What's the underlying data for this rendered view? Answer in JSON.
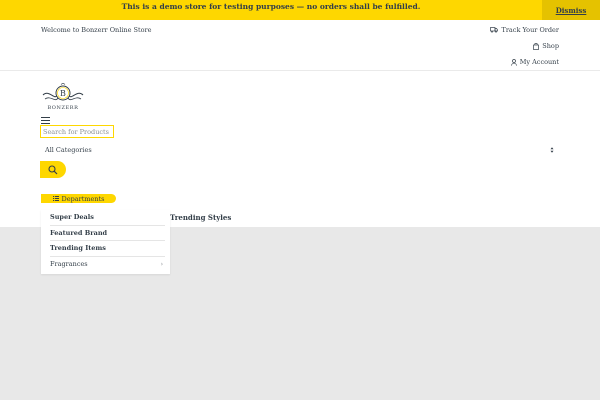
{
  "notice": {
    "text": "This is a demo store for testing purposes — no orders shall be fulfilled.",
    "dismiss_label": "Dismiss"
  },
  "topbar": {
    "welcome": "Welcome to Bonzerr Online Store",
    "links": [
      {
        "label": "Track Your Order",
        "icon": "truck-icon"
      },
      {
        "label": "Shop",
        "icon": "shopping-bag-icon"
      },
      {
        "label": "My Account",
        "icon": "user-icon"
      }
    ]
  },
  "logo": {
    "text": "BONZERR",
    "letter": "B"
  },
  "search": {
    "placeholder": "Search for Products",
    "category": "All Categories",
    "button_icon": "search-icon"
  },
  "departments": {
    "label": "Departments",
    "items": [
      {
        "label": "Super Deals",
        "bold": true
      },
      {
        "label": "Featured Brand",
        "bold": true
      },
      {
        "label": "Trending Items",
        "bold": true
      },
      {
        "label": "Fragrances",
        "bold": false,
        "has_submenu": true
      }
    ]
  },
  "nav": {
    "trending_styles": "Trending Styles"
  },
  "colors": {
    "accent": "#fed700",
    "accent_dark": "#e5c200",
    "text": "#333e48",
    "background": "#e8e8e8"
  }
}
